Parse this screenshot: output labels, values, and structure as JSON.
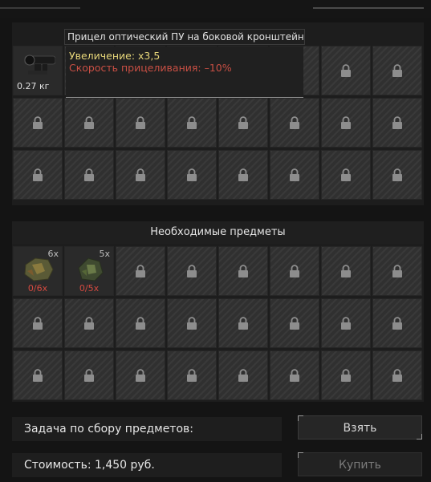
{
  "upgrade_item": {
    "name": "Прицел оптический ПУ на боковой кронштейн",
    "weight": "0.27 кг",
    "stats": {
      "line1": "Увеличение: x3,5",
      "line2": "Скорость прицеливания: –10%"
    }
  },
  "required": {
    "title": "Необходимые предметы",
    "items": [
      {
        "icon": "ore-resource-icon",
        "count": "6x",
        "progress": "0/6x"
      },
      {
        "icon": "green-ore-resource-icon",
        "count": "5x",
        "progress": "0/5x"
      }
    ]
  },
  "task": {
    "label": "Задача по сбору предметов:",
    "cost": "Стоимость: 1,450 руб."
  },
  "buttons": {
    "take": "Взять",
    "buy": "Купить"
  },
  "colors": {
    "accent_yellow": "#e8d77a",
    "warning_red": "#c94f44"
  }
}
